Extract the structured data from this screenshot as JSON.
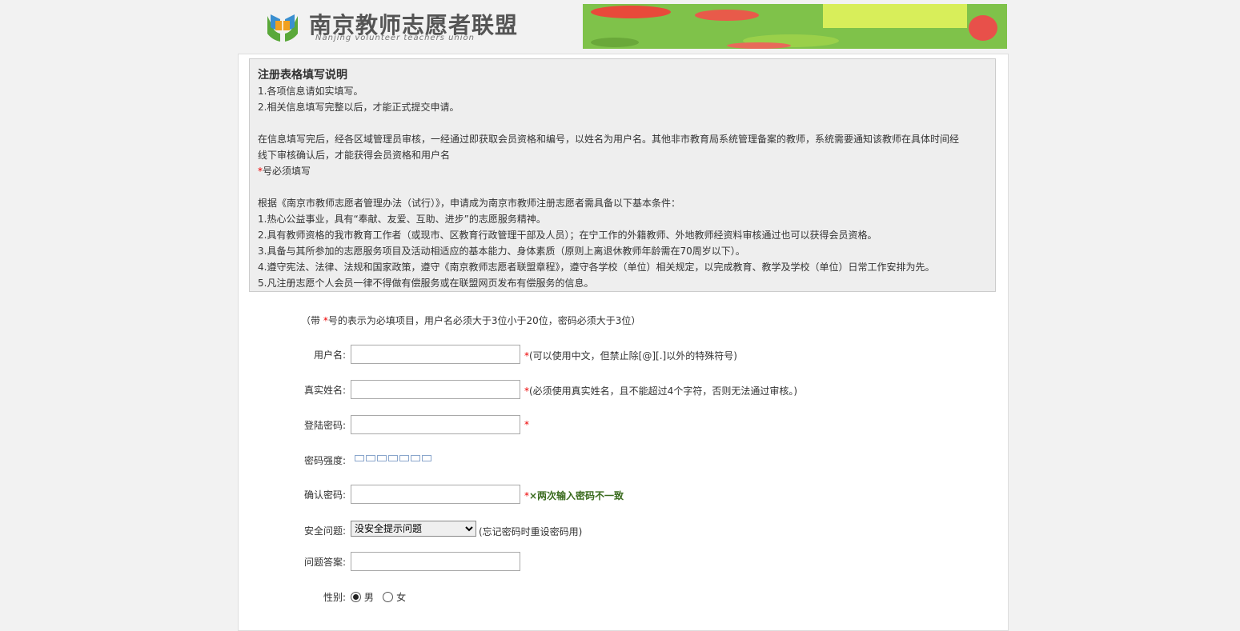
{
  "header": {
    "logo_title": "南京教师志愿者联盟",
    "logo_subtitle": "Nanjing volunteer teachers union"
  },
  "notice": {
    "title": "注册表格填写说明",
    "line1": "1.各项信息请如实填写。",
    "line2": "2.相关信息填写完整以后，才能正式提交申请。",
    "para1a": "在信息填写完后，经各区域管理员审核，一经通过即获取会员资格和编号，以姓名为用户名。其他非市教育局系统管理备案的教师，系统需要通知该教师在具体时间经",
    "para1b": "线下审核确认后，才能获得会员资格和用户名",
    "required_mark": "*",
    "required_note": "号必须填写",
    "cond_intro": "根据《南京市教师志愿者管理办法（试行）》，申请成为南京市教师注册志愿者需具备以下基本条件：",
    "cond1": "1.热心公益事业，具有“奉献、友爱、互助、进步”的志愿服务精神。",
    "cond2": "2.具有教师资格的我市教育工作者（或现市、区教育行政管理干部及人员）；在宁工作的外籍教师、外地教师经资料审核通过也可以获得会员资格。",
    "cond3": "3.具备与其所参加的志愿服务项目及活动相适应的基本能力、身体素质（原则上离退休教师年龄需在70周岁以下）。",
    "cond4": "4.遵守宪法、法律、法规和国家政策，遵守《南京教师志愿者联盟章程》，遵守各学校（单位）相关规定，以完成教育、教学及学校（单位）日常工作安排为先。",
    "cond5": "5.凡注册志愿个人会员一律不得做有偿服务或在联盟网页发布有偿服务的信息。"
  },
  "form": {
    "intro_a": "（带 ",
    "intro_mark": "*",
    "intro_b": "号的表示为必填项目，用户名必须大于3位小于20位，密码必须大于3位）",
    "username_label": "用户名:",
    "username_value": "",
    "username_hint": "(可以使用中文，但禁止除[@][.]以外的特殊符号)",
    "realname_label": "真实姓名:",
    "realname_value": "",
    "realname_hint": "(必须使用真实姓名，且不能超过4个字符，否则无法通过审核。)",
    "password_label": "登陆密码:",
    "password_value": "",
    "strength_label": "密码强度:",
    "confirm_label": "确认密码:",
    "confirm_value": "",
    "confirm_error": "×两次输入密码不一致",
    "question_label": "安全问题:",
    "question_selected": "没安全提示问题",
    "question_hint": "(忘记密码时重设密码用)",
    "answer_label": "问题答案:",
    "answer_value": "",
    "gender_label": "性别:",
    "gender_male": "男",
    "gender_female": "女",
    "required_mark": "*"
  },
  "colors": {
    "required": "#ee0000",
    "error": "#3a6b1e",
    "notice_bg": "#eeeeee"
  }
}
